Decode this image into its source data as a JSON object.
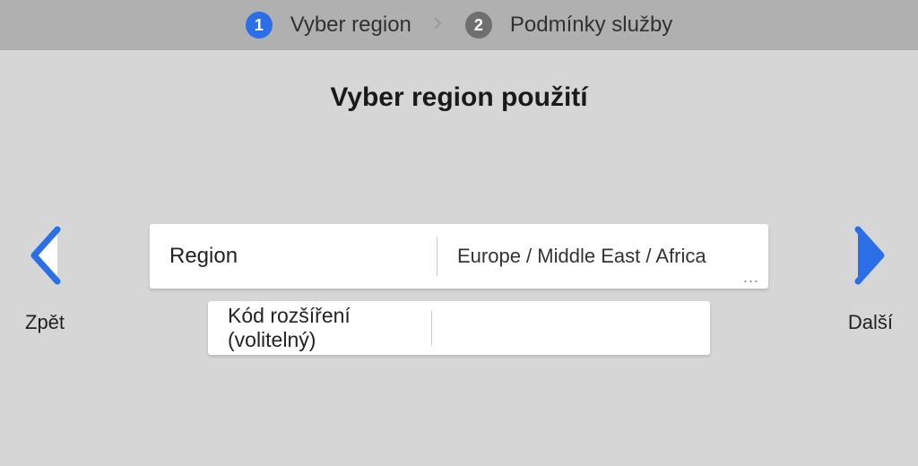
{
  "stepper": {
    "steps": [
      {
        "number": "1",
        "label": "Vyber region",
        "active": true
      },
      {
        "number": "2",
        "label": "Podmínky služby",
        "active": false
      }
    ]
  },
  "title": "Vyber region použití",
  "nav": {
    "back_label": "Zpět",
    "next_label": "Další"
  },
  "region_field": {
    "label": "Region",
    "value": "Europe / Middle East / Africa"
  },
  "code_field": {
    "label": "Kód rozšíření (volitelný)",
    "value": ""
  },
  "ellipsis": "..."
}
